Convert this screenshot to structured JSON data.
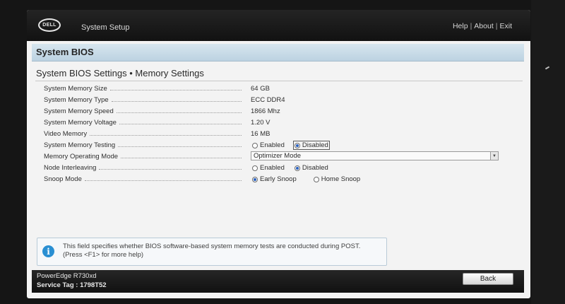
{
  "header": {
    "logo_text": "DELL",
    "app_title": "System Setup",
    "links": [
      "Help",
      "About",
      "Exit"
    ],
    "link_separator": "|"
  },
  "section_title": "System BIOS",
  "breadcrumb": "System BIOS Settings • Memory Settings",
  "settings": {
    "memory_size": {
      "label": "System Memory Size",
      "value": "64 GB"
    },
    "memory_type": {
      "label": "System Memory Type",
      "value": "ECC DDR4"
    },
    "memory_speed": {
      "label": "System Memory Speed",
      "value": "1866 Mhz"
    },
    "memory_voltage": {
      "label": "System Memory Voltage",
      "value": "1.20 V"
    },
    "video_memory": {
      "label": "Video Memory",
      "value": "16 MB"
    },
    "memory_testing": {
      "label": "System Memory Testing",
      "options": [
        "Enabled",
        "Disabled"
      ],
      "selected": "Disabled"
    },
    "operating_mode": {
      "label": "Memory Operating Mode",
      "value": "Optimizer Mode"
    },
    "node_interleaving": {
      "label": "Node Interleaving",
      "options": [
        "Enabled",
        "Disabled"
      ],
      "selected": "Disabled"
    },
    "snoop_mode": {
      "label": "Snoop Mode",
      "options": [
        "Early Snoop",
        "Home Snoop"
      ],
      "selected": "Early Snoop"
    }
  },
  "help": {
    "icon": "info-icon",
    "text": "This field specifies whether BIOS software-based system memory tests are conducted during POST. (Press <F1> for more help)"
  },
  "footer": {
    "model": "PowerEdge R730xd",
    "service_tag": "Service Tag : 1798T52",
    "back_label": "Back"
  },
  "colors": {
    "header_bar": "#1a1a1a",
    "section_band": "#c9dce8",
    "radio_selected": "#2b62c0",
    "info_icon": "#2a8fd2"
  }
}
